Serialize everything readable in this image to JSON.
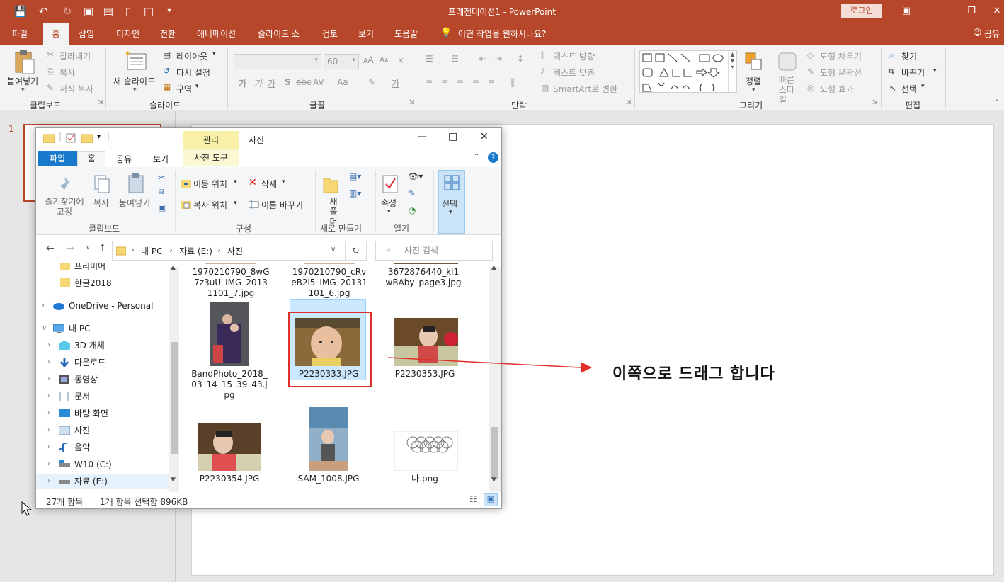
{
  "window": {
    "title": "프레젠테이션1  -  PowerPoint",
    "login_label": "로그인",
    "controls": [
      "minimize-icon",
      "restore-icon",
      "close-icon"
    ]
  },
  "ribbon_tabs": [
    "파일",
    "홈",
    "삽입",
    "디자인",
    "전환",
    "애니메이션",
    "슬라이드 쇼",
    "검토",
    "보기",
    "도움말"
  ],
  "tell_me": "어떤 작업을 원하시나요?",
  "share_label": "공유",
  "ribbon": {
    "clipboard": {
      "paste": "붙여넣기",
      "cut": "잘라내기",
      "copy": "복사",
      "format_painter": "서식 복사",
      "group": "클립보드"
    },
    "slides": {
      "new_slide": "새 슬라이드",
      "layout": "레이아웃",
      "reset": "다시 설정",
      "section": "구역",
      "group": "슬라이드"
    },
    "font": {
      "size": "60",
      "group": "글꼴",
      "buttons": [
        "가",
        "가",
        "가",
        "S",
        "abc",
        "AV",
        "Aa",
        "가"
      ]
    },
    "paragraph": {
      "text_direction": "텍스트 방향",
      "align_text": "텍스트 맞춤",
      "smartart": "SmartArt로 변환",
      "group": "단락"
    },
    "drawing": {
      "arrange": "정렬",
      "quick_styles": "빠른 스타일",
      "shape_fill": "도형 채우기",
      "shape_outline": "도형 윤곽선",
      "shape_effects": "도형 효과",
      "group": "그리기"
    },
    "editing": {
      "find": "찾기",
      "replace": "바꾸기",
      "select": "선택",
      "group": "편집"
    }
  },
  "slide_number": "1",
  "annotation": "이쪽으로 드래그 합니다",
  "explorer": {
    "context_tab": "관리",
    "title": "사진",
    "tabs": [
      "파일",
      "홈",
      "공유",
      "보기"
    ],
    "tools_tab": "사진 도구",
    "ribbon": {
      "pin": "즐겨찾기에 고정",
      "copy": "복사",
      "paste": "붙여넣기",
      "clipboard_group": "클립보드",
      "move_to": "이동 위치",
      "copy_to": "복사 위치",
      "delete": "삭제",
      "rename": "이름 바꾸기",
      "organize_group": "구성",
      "new_folder": "새 폴더",
      "new_group": "새로 만들기",
      "properties": "속성",
      "open_group": "열기",
      "select": "선택"
    },
    "breadcrumb": [
      "내 PC",
      "자료 (E:)",
      "사진"
    ],
    "search_placeholder": "사진 검색",
    "nav": [
      {
        "label": "프리미어",
        "icon": "folder-icon"
      },
      {
        "label": "한글2018",
        "icon": "folder-icon"
      },
      {
        "label": "OneDrive - Personal",
        "icon": "cloud-icon"
      },
      {
        "label": "내 PC",
        "icon": "computer-icon"
      },
      {
        "label": "3D 개체",
        "icon": "cube-icon"
      },
      {
        "label": "다운로드",
        "icon": "download-icon"
      },
      {
        "label": "동영상",
        "icon": "video-icon"
      },
      {
        "label": "문서",
        "icon": "document-icon"
      },
      {
        "label": "바탕 화면",
        "icon": "desktop-icon"
      },
      {
        "label": "사진",
        "icon": "pictures-icon"
      },
      {
        "label": "음악",
        "icon": "music-icon"
      },
      {
        "label": "W10 (C:)",
        "icon": "drive-icon"
      },
      {
        "label": "자료 (E:)",
        "icon": "drive-icon"
      }
    ],
    "files": [
      {
        "name": "1970210790_8wG7z3uU_IMG_20131101_7.jpg"
      },
      {
        "name": "1970210790_cRveB2l5_IMG_20131101_6.jpg"
      },
      {
        "name": "3672876440_kl1wBAby_page3.jpg"
      },
      {
        "name": "BandPhoto_2018_03_14_15_39_43.jpg"
      },
      {
        "name": "P2230333.JPG"
      },
      {
        "name": "P2230353.JPG"
      },
      {
        "name": "P2230354.JPG"
      },
      {
        "name": "SAM_1008.JPG"
      },
      {
        "name": "나.png"
      }
    ],
    "status_count": "27개 항목",
    "status_selected": "1개 항목 선택함 896KB"
  }
}
